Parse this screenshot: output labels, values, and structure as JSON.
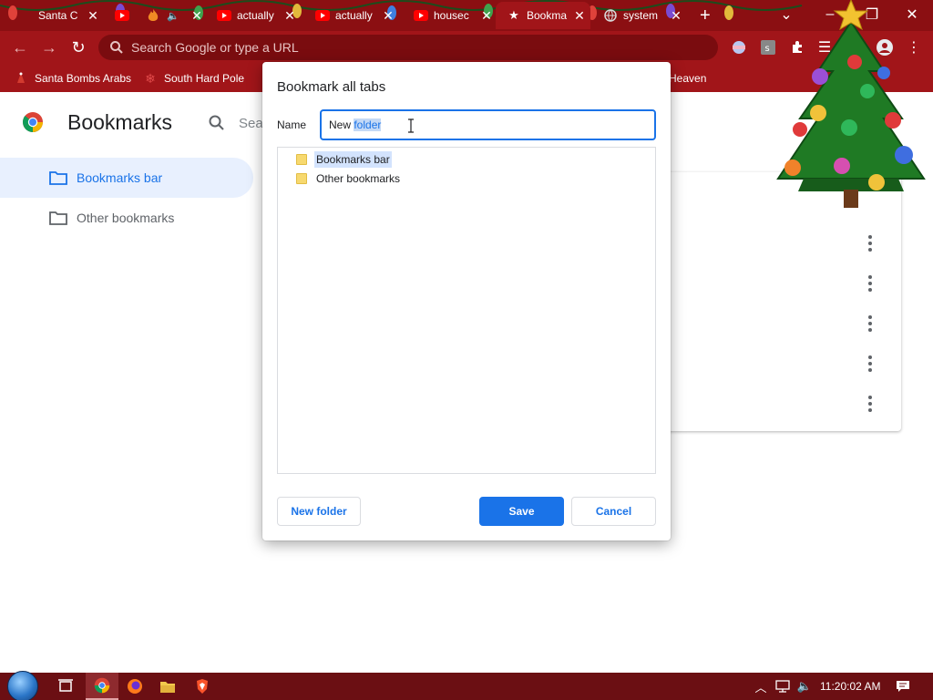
{
  "browser": {
    "tabs": [
      {
        "title": "Santa C",
        "icon": "santa-icon",
        "active": false
      },
      {
        "title": "",
        "icon": "youtube-icon",
        "active": false
      },
      {
        "title": "",
        "icon": "fire-icon",
        "active": false
      },
      {
        "title": "actually",
        "icon": "youtube-icon",
        "active": false
      },
      {
        "title": "actually",
        "icon": "youtube-icon",
        "active": false
      },
      {
        "title": "housec",
        "icon": "youtube-icon",
        "active": false
      },
      {
        "title": "Bookma",
        "icon": "star-icon",
        "active": true
      },
      {
        "title": "system",
        "icon": "globe-icon",
        "active": false
      }
    ],
    "omnibox_placeholder": "Search Google or type a URL",
    "bookmarks_bar": [
      {
        "label": "Santa Bombs Arabs",
        "icon": "santa-icon"
      },
      {
        "label": "South Hard Pole",
        "icon": "snowflake-icon"
      },
      {
        "label": "Heaven",
        "icon": "bookmark-icon"
      }
    ],
    "theme": {
      "frame": "#8b0f12",
      "toolbar": "#a11519",
      "accent": "#1a73e8"
    }
  },
  "bookmarks_page": {
    "title": "Bookmarks",
    "search_placeholder": "Sea",
    "sidebar": [
      {
        "label": "Bookmarks bar",
        "selected": true
      },
      {
        "label": "Other bookmarks",
        "selected": false
      }
    ]
  },
  "dialog": {
    "title": "Bookmark all tabs",
    "name_label": "Name",
    "name_value_plain": "New ",
    "name_value_selected": "folder",
    "folders": [
      {
        "label": "Bookmarks bar",
        "selected": true
      },
      {
        "label": "Other bookmarks",
        "selected": false
      }
    ],
    "new_folder_button": "New folder",
    "save_button": "Save",
    "cancel_button": "Cancel"
  },
  "taskbar": {
    "clock": "11:20:02 AM",
    "apps": [
      "task-view-icon",
      "chrome-icon",
      "firefox-icon",
      "file-explorer-icon",
      "brave-icon"
    ]
  }
}
